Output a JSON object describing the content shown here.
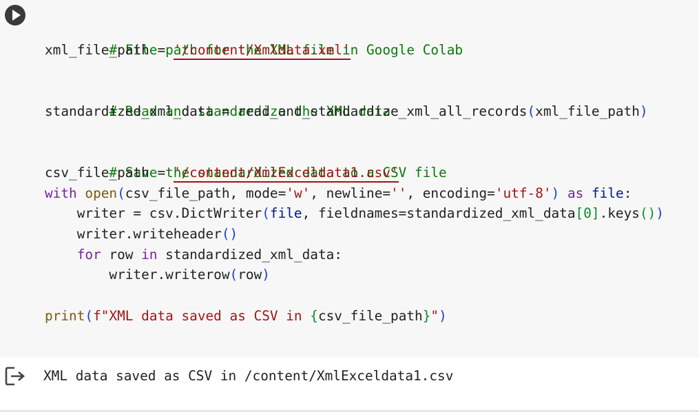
{
  "cell": {
    "run_button_label": "Run cell",
    "code": {
      "line1_comment": "# File path for the XML file in Google Colab",
      "line2_var": "xml_file_path",
      "line2_eq": " = ",
      "line2_str": "'/content/Xmldata.xml'",
      "line4_comment": "# Read and standardize the XML data",
      "line5_var": "standardized_xml_data",
      "line5_eq": " = ",
      "line5_func": "read_and_standardize_xml_all_records",
      "line5_open": "(",
      "line5_arg": "xml_file_path",
      "line5_close": ")",
      "line7_comment": "# Save the standardized data to a CSV file",
      "line8_var": "csv_file_path",
      "line8_eq": " = ",
      "line8_str": "'/content/XmlExceldata1.csv'",
      "line9_with": "with",
      "line9_sp1": " ",
      "line9_open_fn": "open",
      "line9_paren": "(",
      "line9_arg1": "csv_file_path, mode=",
      "line9_mode": "'w'",
      "line9_sep1": ", newline=",
      "line9_newline": "''",
      "line9_sep2": ", encoding=",
      "line9_enc": "'utf-8'",
      "line9_cparen": ")",
      "line9_sp2": " ",
      "line9_as": "as",
      "line9_sp3": " ",
      "line9_file": "file",
      "line9_colon": ":",
      "line10_a": "    writer = csv.DictWriter",
      "line10_p1": "(",
      "line10_file": "file",
      "line10_b": ", fieldnames=standardized_xml_data",
      "line10_br1": "[",
      "line10_zero": "0",
      "line10_br2": "]",
      "line10_c": ".keys",
      "line10_p2": "()",
      "line10_p3": ")",
      "line11_a": "    writer.writeheader",
      "line11_p": "()",
      "line12_ind": "    ",
      "line12_for": "for",
      "line12_b": " row ",
      "line12_in": "in",
      "line12_c": " standardized_xml_data:",
      "line13_a": "        writer.writerow",
      "line13_p1": "(",
      "line13_row": "row",
      "line13_p2": ")",
      "line15_print": "print",
      "line15_p1": "(",
      "line15_fstr1": "f\"XML data saved as CSV in ",
      "line15_brace1": "{",
      "line15_var": "csv_file_path",
      "line15_brace2": "}",
      "line15_fstr2": "\"",
      "line15_p2": ")"
    }
  },
  "output": {
    "icon": "output-redirect-icon",
    "text": "XML data saved as CSV in /content/XmlExceldata1.csv"
  }
}
